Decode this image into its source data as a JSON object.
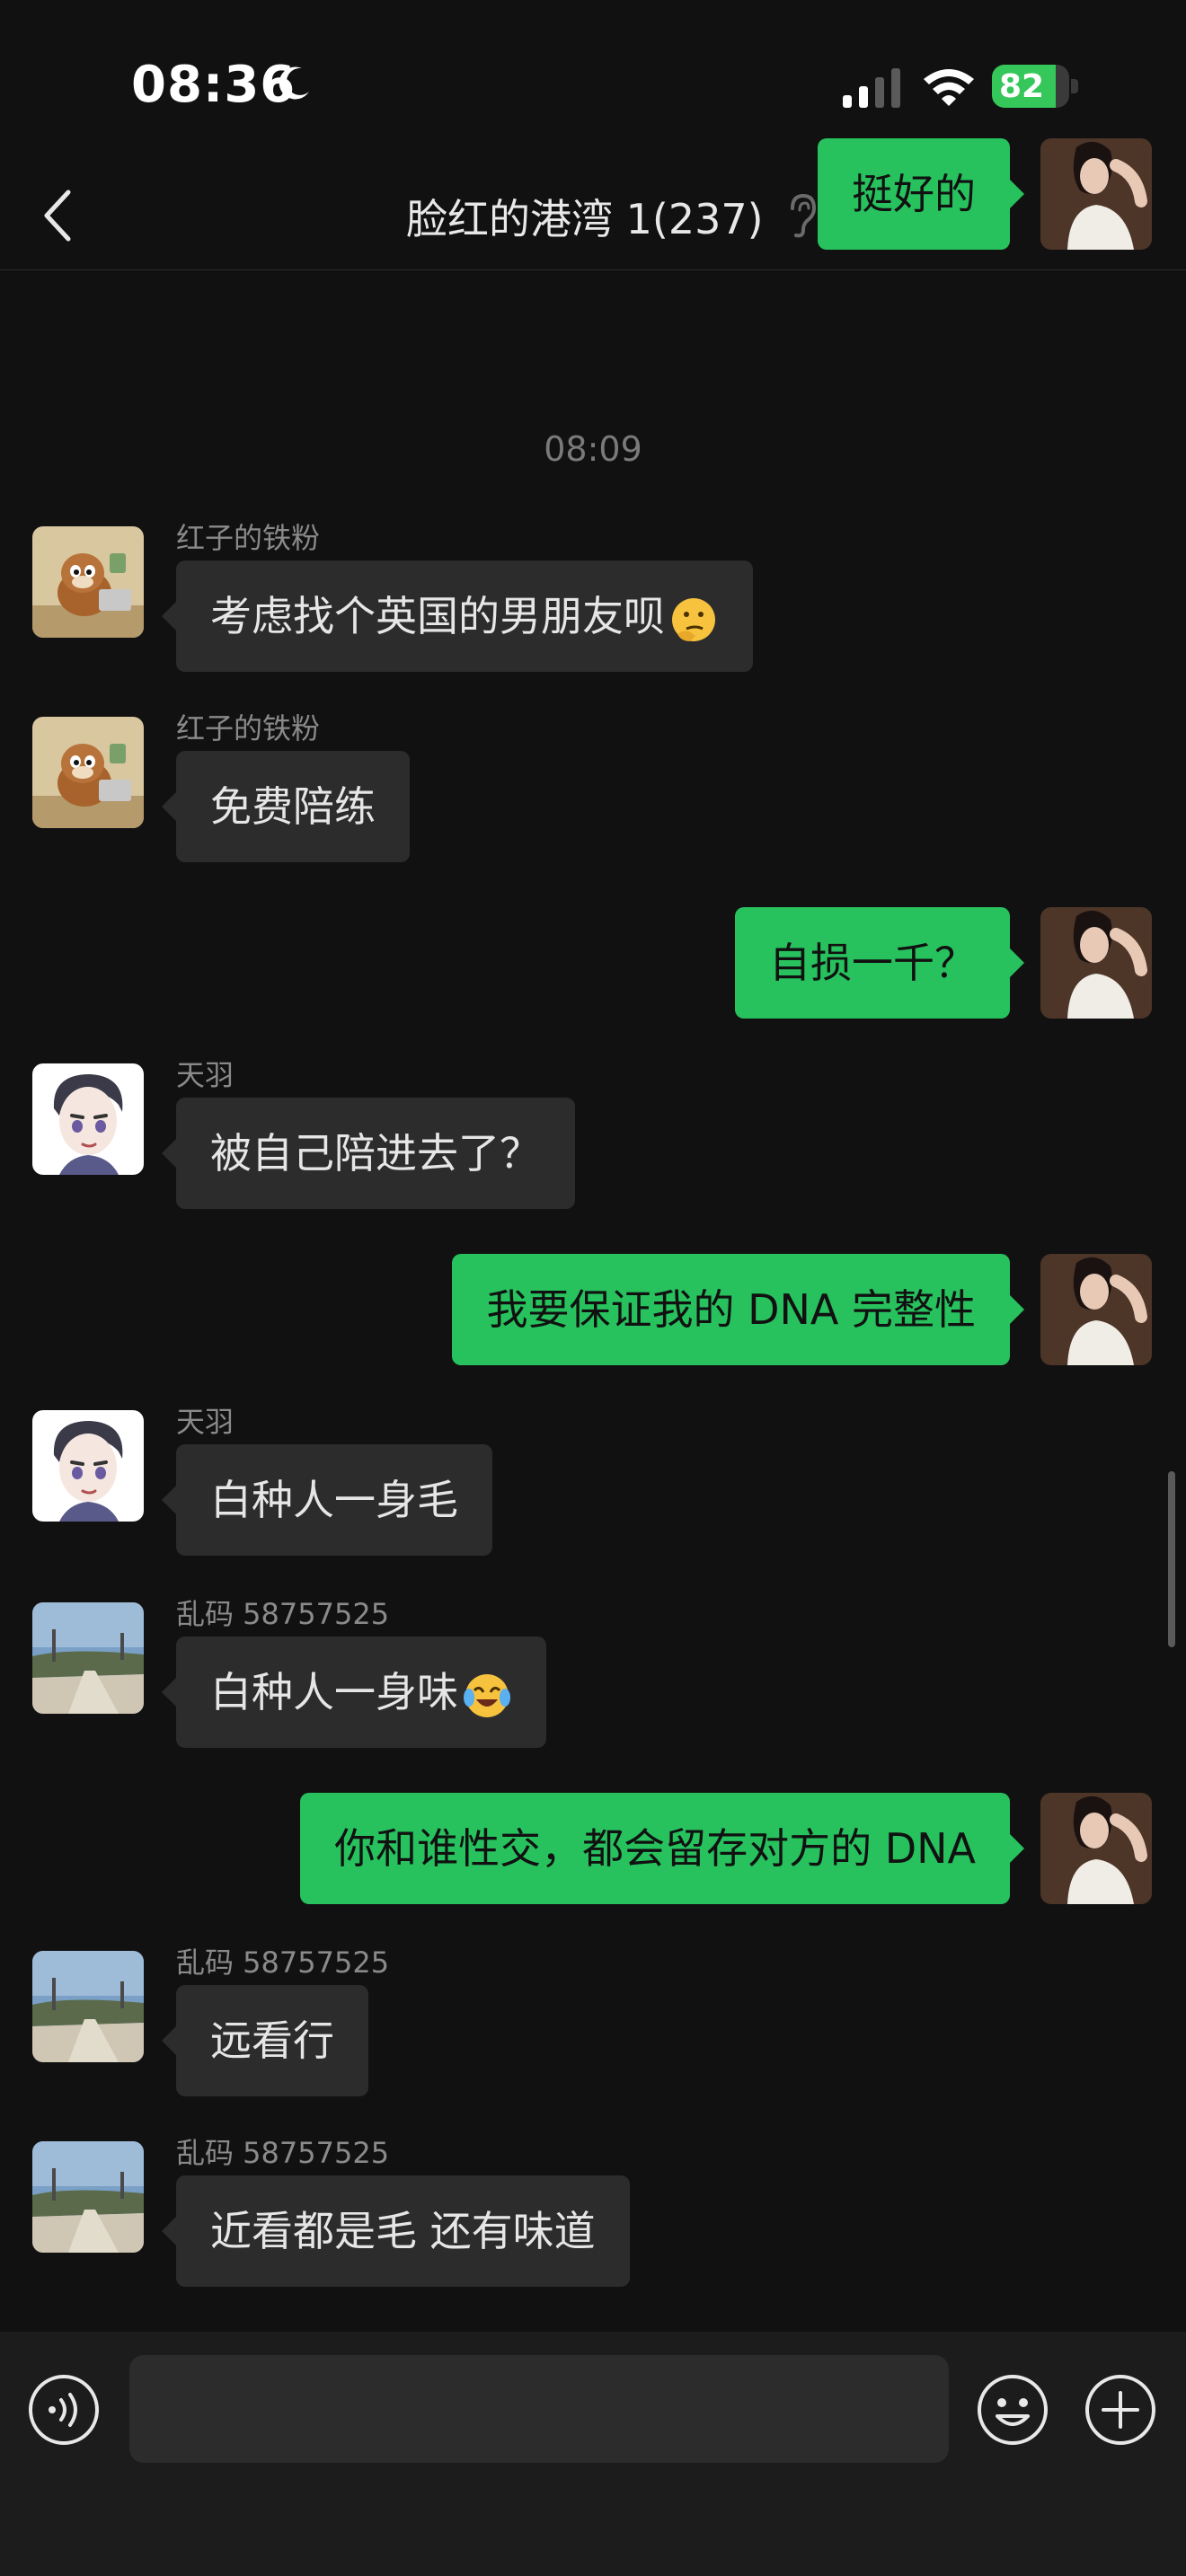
{
  "status_bar": {
    "time": "08:36",
    "battery_percent": 82,
    "battery_label": "82"
  },
  "nav": {
    "title": "脸红的港湾 1(237)",
    "icons": [
      "chevron-left-icon",
      "ear-icon",
      "muted-bell-icon",
      "more-icon"
    ]
  },
  "timestamp": "08:09",
  "messages": [
    {
      "side": "right",
      "text": "挺好的",
      "avatar": "self-avatar"
    },
    {
      "side": "left",
      "sender": "红子的铁粉",
      "text": "考虑找个英国的男朋友呗",
      "emoji": "thinking-face-emoji",
      "avatar": "chipmunk-avatar"
    },
    {
      "side": "left",
      "sender": "红子的铁粉",
      "text": "免费陪练",
      "avatar": "chipmunk-avatar"
    },
    {
      "side": "right",
      "text": "自损一千？",
      "avatar": "self-avatar"
    },
    {
      "side": "left",
      "sender": "天羽",
      "text": "被自己陪进去了？",
      "avatar": "cartoon-boy-avatar"
    },
    {
      "side": "right",
      "text": "我要保证我的 DNA 完整性",
      "avatar": "self-avatar"
    },
    {
      "side": "left",
      "sender": "天羽",
      "text": "白种人一身毛",
      "avatar": "cartoon-boy-avatar"
    },
    {
      "side": "left",
      "sender": "乱码 58757525",
      "text": "白种人一身味",
      "emoji": "crying-laughing-emoji",
      "avatar": "street-photo-avatar"
    },
    {
      "side": "right",
      "text": "你和谁性交，都会留存对方的 DNA",
      "avatar": "self-avatar"
    },
    {
      "side": "left",
      "sender": "乱码 58757525",
      "text": "远看行",
      "avatar": "street-photo-avatar"
    },
    {
      "side": "left",
      "sender": "乱码 58757525",
      "text": "近看都是毛 还有味道",
      "avatar": "street-photo-avatar"
    }
  ],
  "input_bar": {
    "icons": [
      "voice-icon",
      "emoji-icon",
      "plus-icon"
    ],
    "placeholder": ""
  },
  "colors": {
    "background": "#111111",
    "bubble_self": "#27c25e",
    "bubble_other": "#2c2c2c"
  }
}
